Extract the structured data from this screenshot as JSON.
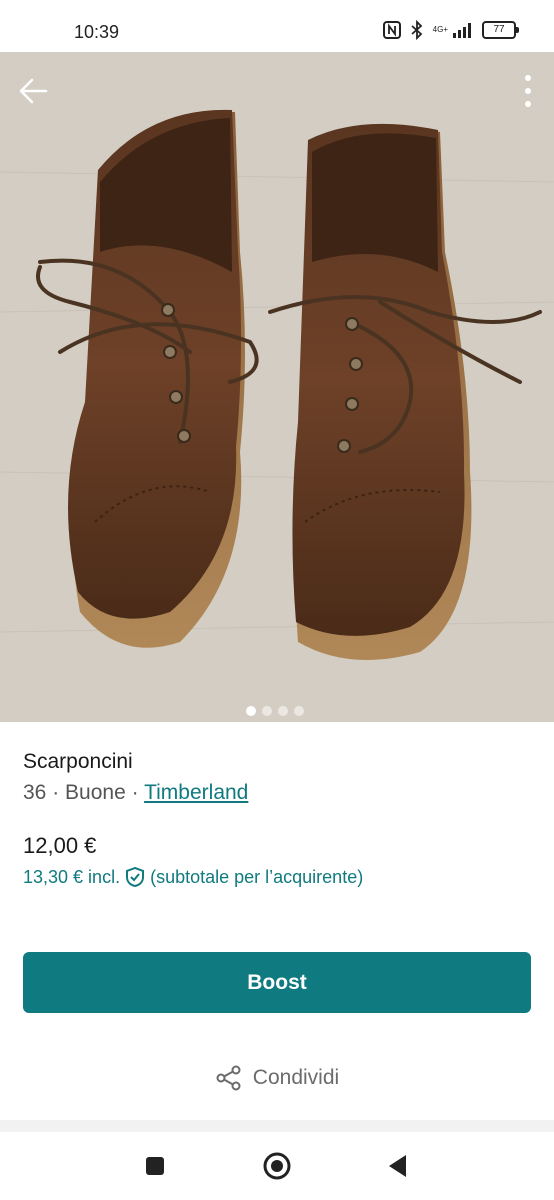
{
  "status": {
    "time": "10:39",
    "network": "4G+",
    "battery": "77"
  },
  "listing": {
    "title": "Scarponcini",
    "size": "36",
    "condition": "Buone",
    "separator": "·",
    "brand": "Timberland",
    "price": "12,00 €",
    "total_price": "13,30 € incl.",
    "total_note": "(subtotale per l’acquirente)",
    "photo_count": 4,
    "active_photo": 1
  },
  "actions": {
    "boost_label": "Boost",
    "share_label": "Condividi"
  },
  "colors": {
    "accent": "#0f7a7f"
  },
  "icons": [
    "back-arrow-icon",
    "more-vertical-icon",
    "shield-check-icon",
    "share-icon",
    "nfc-icon",
    "bluetooth-icon",
    "signal-icon",
    "battery-icon",
    "nav-square-icon",
    "nav-home-icon",
    "nav-back-icon"
  ]
}
